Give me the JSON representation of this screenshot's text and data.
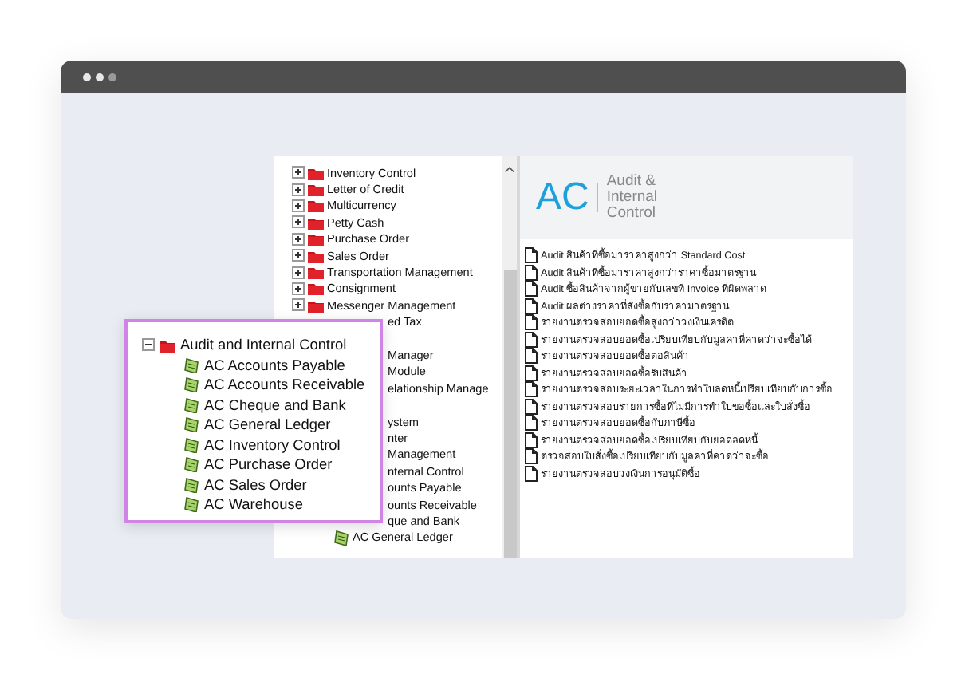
{
  "tree": [
    {
      "kind": "folder",
      "label": "Inventory Control"
    },
    {
      "kind": "folder",
      "label": "Letter of Credit"
    },
    {
      "kind": "folder",
      "label": "Multicurrency"
    },
    {
      "kind": "folder",
      "label": "Petty Cash"
    },
    {
      "kind": "folder",
      "label": "Purchase Order"
    },
    {
      "kind": "folder",
      "label": "Sales Order"
    },
    {
      "kind": "folder",
      "label": "Transportation Management"
    },
    {
      "kind": "folder",
      "label": "Consignment"
    },
    {
      "kind": "folder",
      "label": "Messenger Management"
    },
    {
      "kind": "covered",
      "label": "ed Tax"
    },
    {
      "kind": "covered"
    },
    {
      "kind": "covered",
      "label": "Manager"
    },
    {
      "kind": "covered",
      "label": "Module"
    },
    {
      "kind": "covered",
      "label": "elationship Manage"
    },
    {
      "kind": "covered"
    },
    {
      "kind": "covered",
      "label": "ystem"
    },
    {
      "kind": "covered",
      "label": "nter"
    },
    {
      "kind": "covered",
      "label": "Management"
    },
    {
      "kind": "covered",
      "label": "nternal Control"
    },
    {
      "kind": "covered",
      "label": "ounts Payable"
    },
    {
      "kind": "covered",
      "label": "ounts Receivable"
    },
    {
      "kind": "covered",
      "label": "que and Bank"
    },
    {
      "kind": "module",
      "label": "AC General Ledger"
    }
  ],
  "header": {
    "logo": "AC",
    "title": "Audit & Internal Control"
  },
  "reports": [
    "Audit สินค้าที่ซื้อมาราคาสูงกว่า Standard Cost",
    "Audit สินค้าที่ซื้อมาราคาสูงกว่าราคาซื้อมาตรฐาน",
    "Audit ซื้อสินค้าจากผู้ขายกับเลขที่ Invoice ที่ผิดพลาด",
    "Audit ผลต่างราคาที่สั่งซื้อกับราคามาตรฐาน",
    "รายงานตรวจสอบยอดซื้อสูงกว่าวงเงินเครดิต",
    "รายงานตรวจสอบยอดซื้อเปรียบเทียบกับมูลค่าที่คาดว่าจะซื้อได้",
    "รายงานตรวจสอบยอดซื้อต่อสินค้า",
    "รายงานตรวจสอบยอดซื้อรับสินค้า",
    "รายงานตรวจสอบระยะเวลาในการทำใบลดหนี้เปรียบเทียบกับการซื้อ",
    "รายงานตรวจสอบรายการซื้อที่ไม่มีการทำใบขอซื้อและใบสั่งซื้อ",
    "รายงานตรวจสอบยอดซื้อกับภาษีซื้อ",
    "รายงานตรวจสอบยอดซื้อเปรียบเทียบกับยอดลดหนี้",
    "ตรวจสอบใบสั่งซื้อเปรียบเทียบกับมูลค่าที่คาดว่าจะซื้อ",
    "รายงานตรวจสอบวงเงินการอนุมัติซื้อ"
  ],
  "callout": {
    "label": "Audit and Internal Control",
    "expanded": true,
    "children": [
      {
        "label": "AC Accounts Payable"
      },
      {
        "label": "AC Accounts Receivable"
      },
      {
        "label": "AC Cheque and Bank"
      },
      {
        "label": "AC General Ledger"
      },
      {
        "label": "AC Inventory Control"
      },
      {
        "label": "AC Purchase Order"
      },
      {
        "label": "AC Sales Order"
      },
      {
        "label": "AC Warehouse"
      }
    ]
  }
}
